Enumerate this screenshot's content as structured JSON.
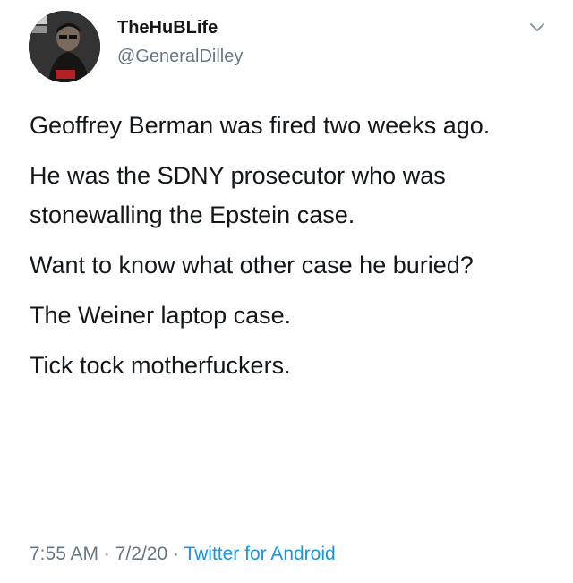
{
  "tweet": {
    "display_name": "TheHuBLife",
    "handle": "@GeneralDilley",
    "paragraphs": [
      "Geoffrey Berman was fired two weeks ago.",
      "He was the SDNY prosecutor who was stonewalling the Epstein case.",
      "Want to know what other case he buried?",
      "The Weiner laptop case.",
      "Tick tock motherfuckers."
    ],
    "time": "7:55 AM",
    "date": "7/2/20",
    "separator": "·",
    "source": "Twitter for Android"
  },
  "icons": {
    "caret": "chevron-down-icon",
    "avatar": "profile-photo"
  },
  "colors": {
    "text": "#14171a",
    "secondary": "#657786",
    "link": "#1b95e0",
    "background": "#ffffff"
  }
}
